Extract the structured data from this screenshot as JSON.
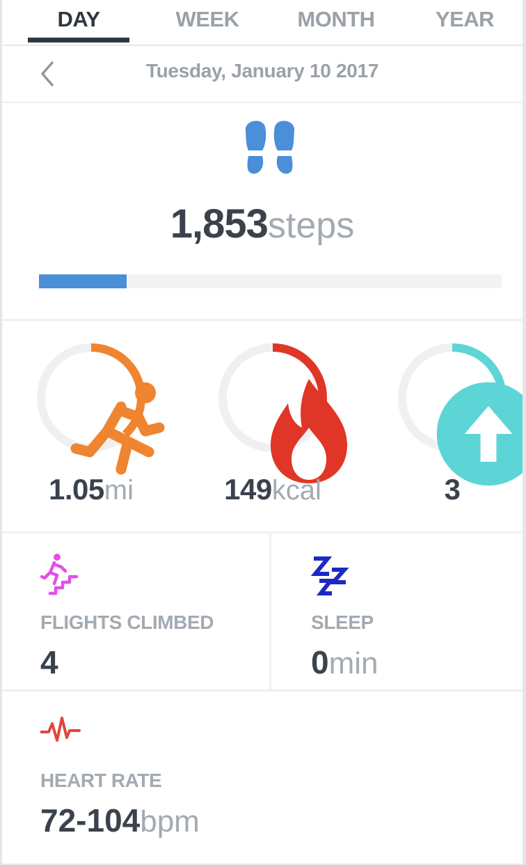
{
  "tabs": [
    {
      "label": "DAY",
      "active": true
    },
    {
      "label": "WEEK",
      "active": false
    },
    {
      "label": "MONTH",
      "active": false
    },
    {
      "label": "YEAR",
      "active": false
    }
  ],
  "date": "Tuesday, January 10 2017",
  "steps": {
    "icon": "footprints-icon",
    "value": "1,853",
    "unit": "steps",
    "progress_fraction": 0.19,
    "color": "#4a8fd8"
  },
  "rings": [
    {
      "name": "distance",
      "icon": "running-icon",
      "value": "1.05",
      "unit": "mi",
      "progress_fraction": 0.38,
      "color": "#ef8530"
    },
    {
      "name": "calories",
      "icon": "flame-icon",
      "value": "149",
      "unit": "kcal",
      "progress_fraction": 0.36,
      "color": "#e03628"
    },
    {
      "name": "flights",
      "icon": "arrow-up-circle-icon",
      "value": "3",
      "unit": "",
      "progress_fraction": 0.24,
      "color": "#5dd5d6"
    }
  ],
  "stats": {
    "flights": {
      "icon": "stairs-climber-icon",
      "label": "FLIGHTS CLIMBED",
      "value": "4",
      "unit": "",
      "color": "#e44fe8"
    },
    "sleep": {
      "icon": "sleep-zzz-icon",
      "label": "SLEEP",
      "value": "0",
      "unit": "min",
      "color": "#1d28c4"
    },
    "heart": {
      "icon": "heartbeat-icon",
      "label": "HEART RATE",
      "value": "72-104",
      "unit": "bpm",
      "color": "#e0463c"
    }
  },
  "colors": {
    "track": "#eef0f2",
    "text_dark": "#3a424c",
    "text_muted": "#a3aab1"
  }
}
